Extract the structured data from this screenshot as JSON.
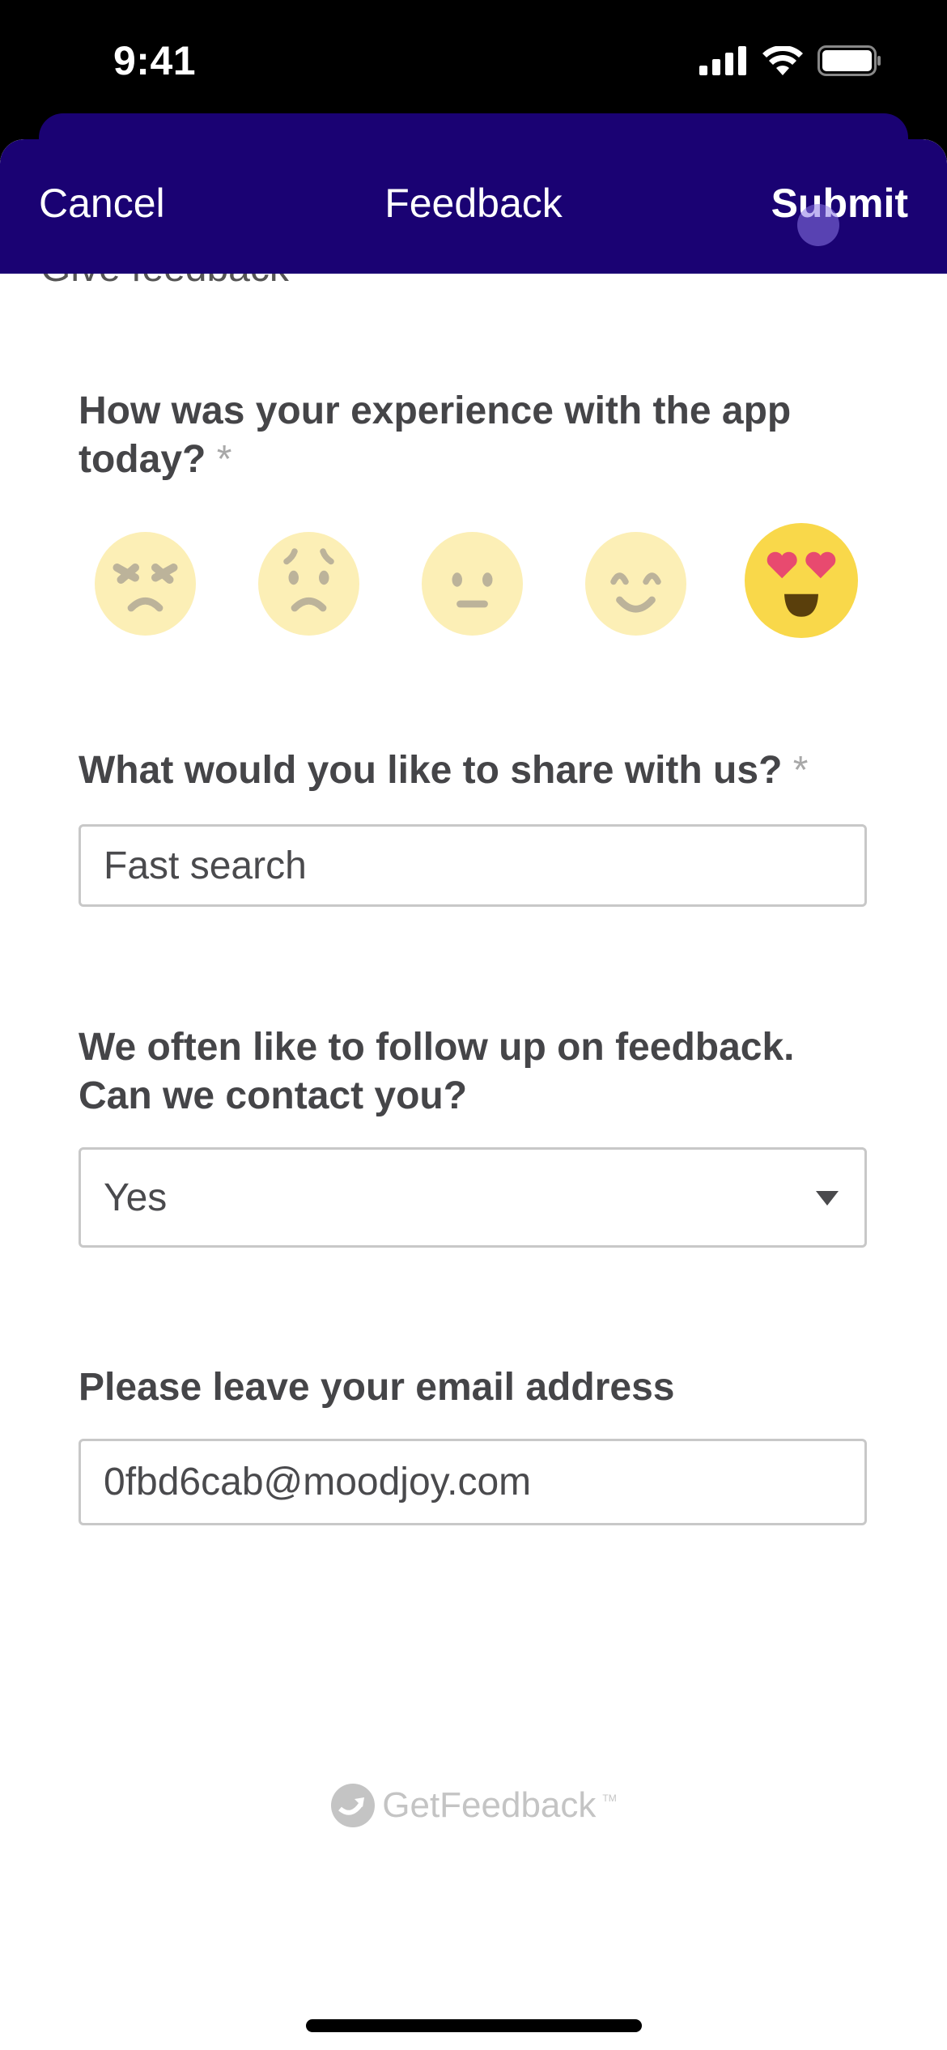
{
  "status_bar": {
    "time": "9:41",
    "icons": [
      "signal-icon",
      "wifi-icon",
      "battery-icon"
    ]
  },
  "nav": {
    "cancel_label": "Cancel",
    "title": "Feedback",
    "submit_label": "Submit"
  },
  "page_title_partial": "Give feedback",
  "questions": {
    "experience": {
      "label": "How was your experience with the app today?",
      "required_mark": "*",
      "options": [
        {
          "name": "angry",
          "selected": false
        },
        {
          "name": "sad",
          "selected": false
        },
        {
          "name": "neutral",
          "selected": false
        },
        {
          "name": "happy",
          "selected": false
        },
        {
          "name": "love",
          "selected": true
        }
      ],
      "selected_rating": 5,
      "max_rating": 5
    },
    "share": {
      "label": "What would you like to share with us?",
      "required_mark": "*",
      "value": "Fast search"
    },
    "contact": {
      "label_line1": "We often like to follow up on feedback.",
      "label_line2": "Can we contact you?",
      "value": "Yes"
    },
    "email": {
      "label": "Please leave your email address",
      "value": "0fbd6cab@moodjoy.com"
    }
  },
  "footer": {
    "brand": "GetFeedback",
    "tm": "TM"
  },
  "colors": {
    "nav_bg": "#1a0273",
    "emoji_inactive": "#fcefb6",
    "emoji_active": "#f9d84a",
    "heart": "#e84a6f",
    "text": "#454548"
  }
}
